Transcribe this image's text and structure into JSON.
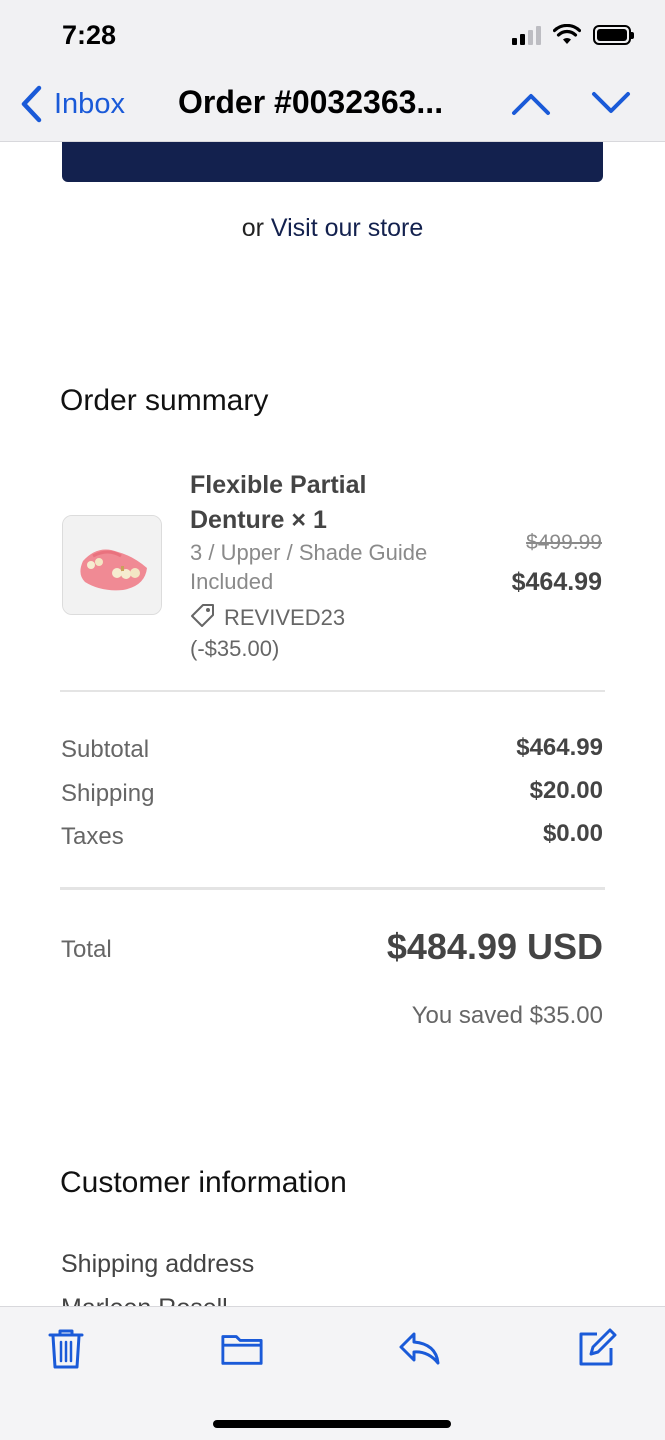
{
  "status_bar": {
    "time": "7:28"
  },
  "nav": {
    "back_label": "Inbox",
    "title": "Order #0032363..."
  },
  "store_link": {
    "prefix": "or ",
    "link": "Visit our store"
  },
  "order_summary": {
    "heading": "Order summary",
    "item": {
      "name": "Flexible Partial Denture × 1",
      "variant": "3 / Upper / Shade Guide Included",
      "discount": "REVIVED23 (-$35.00)",
      "price_original": "$499.99",
      "price_final": "$464.99"
    },
    "rows": [
      {
        "label": "Subtotal",
        "value": "$464.99"
      },
      {
        "label": "Shipping",
        "value": "$20.00"
      },
      {
        "label": "Taxes",
        "value": "$0.00"
      }
    ],
    "total_label": "Total",
    "total_value": "$484.99 USD",
    "saved": "You saved $35.00"
  },
  "customer": {
    "heading": "Customer information",
    "shipping_label": "Shipping address",
    "partial_name": "Marleen Rosell"
  },
  "toolbar": {
    "icons": [
      "trash-icon",
      "folder-icon",
      "reply-icon",
      "compose-icon"
    ]
  },
  "colors": {
    "accent": "#1a5ad8",
    "brand_dark": "#13214e"
  }
}
